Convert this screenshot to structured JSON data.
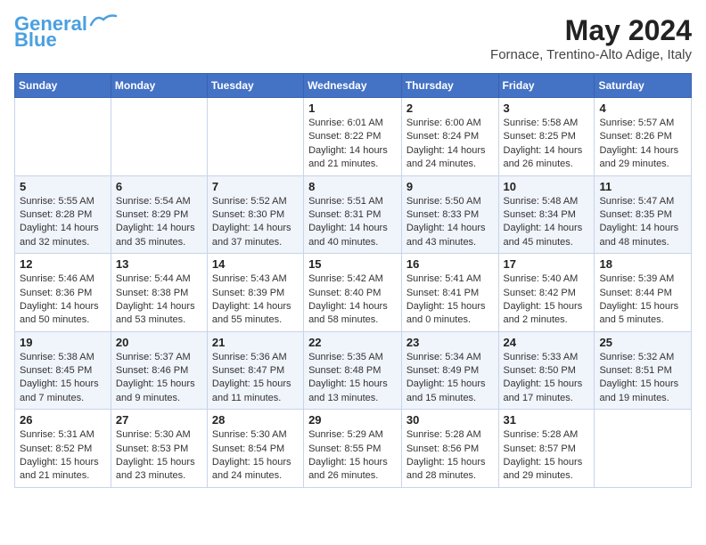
{
  "header": {
    "logo_line1": "General",
    "logo_line2": "Blue",
    "month": "May 2024",
    "location": "Fornace, Trentino-Alto Adige, Italy"
  },
  "weekdays": [
    "Sunday",
    "Monday",
    "Tuesday",
    "Wednesday",
    "Thursday",
    "Friday",
    "Saturday"
  ],
  "weeks": [
    [
      {
        "day": "",
        "info": ""
      },
      {
        "day": "",
        "info": ""
      },
      {
        "day": "",
        "info": ""
      },
      {
        "day": "1",
        "info": "Sunrise: 6:01 AM\nSunset: 8:22 PM\nDaylight: 14 hours and 21 minutes."
      },
      {
        "day": "2",
        "info": "Sunrise: 6:00 AM\nSunset: 8:24 PM\nDaylight: 14 hours and 24 minutes."
      },
      {
        "day": "3",
        "info": "Sunrise: 5:58 AM\nSunset: 8:25 PM\nDaylight: 14 hours and 26 minutes."
      },
      {
        "day": "4",
        "info": "Sunrise: 5:57 AM\nSunset: 8:26 PM\nDaylight: 14 hours and 29 minutes."
      }
    ],
    [
      {
        "day": "5",
        "info": "Sunrise: 5:55 AM\nSunset: 8:28 PM\nDaylight: 14 hours and 32 minutes."
      },
      {
        "day": "6",
        "info": "Sunrise: 5:54 AM\nSunset: 8:29 PM\nDaylight: 14 hours and 35 minutes."
      },
      {
        "day": "7",
        "info": "Sunrise: 5:52 AM\nSunset: 8:30 PM\nDaylight: 14 hours and 37 minutes."
      },
      {
        "day": "8",
        "info": "Sunrise: 5:51 AM\nSunset: 8:31 PM\nDaylight: 14 hours and 40 minutes."
      },
      {
        "day": "9",
        "info": "Sunrise: 5:50 AM\nSunset: 8:33 PM\nDaylight: 14 hours and 43 minutes."
      },
      {
        "day": "10",
        "info": "Sunrise: 5:48 AM\nSunset: 8:34 PM\nDaylight: 14 hours and 45 minutes."
      },
      {
        "day": "11",
        "info": "Sunrise: 5:47 AM\nSunset: 8:35 PM\nDaylight: 14 hours and 48 minutes."
      }
    ],
    [
      {
        "day": "12",
        "info": "Sunrise: 5:46 AM\nSunset: 8:36 PM\nDaylight: 14 hours and 50 minutes."
      },
      {
        "day": "13",
        "info": "Sunrise: 5:44 AM\nSunset: 8:38 PM\nDaylight: 14 hours and 53 minutes."
      },
      {
        "day": "14",
        "info": "Sunrise: 5:43 AM\nSunset: 8:39 PM\nDaylight: 14 hours and 55 minutes."
      },
      {
        "day": "15",
        "info": "Sunrise: 5:42 AM\nSunset: 8:40 PM\nDaylight: 14 hours and 58 minutes."
      },
      {
        "day": "16",
        "info": "Sunrise: 5:41 AM\nSunset: 8:41 PM\nDaylight: 15 hours and 0 minutes."
      },
      {
        "day": "17",
        "info": "Sunrise: 5:40 AM\nSunset: 8:42 PM\nDaylight: 15 hours and 2 minutes."
      },
      {
        "day": "18",
        "info": "Sunrise: 5:39 AM\nSunset: 8:44 PM\nDaylight: 15 hours and 5 minutes."
      }
    ],
    [
      {
        "day": "19",
        "info": "Sunrise: 5:38 AM\nSunset: 8:45 PM\nDaylight: 15 hours and 7 minutes."
      },
      {
        "day": "20",
        "info": "Sunrise: 5:37 AM\nSunset: 8:46 PM\nDaylight: 15 hours and 9 minutes."
      },
      {
        "day": "21",
        "info": "Sunrise: 5:36 AM\nSunset: 8:47 PM\nDaylight: 15 hours and 11 minutes."
      },
      {
        "day": "22",
        "info": "Sunrise: 5:35 AM\nSunset: 8:48 PM\nDaylight: 15 hours and 13 minutes."
      },
      {
        "day": "23",
        "info": "Sunrise: 5:34 AM\nSunset: 8:49 PM\nDaylight: 15 hours and 15 minutes."
      },
      {
        "day": "24",
        "info": "Sunrise: 5:33 AM\nSunset: 8:50 PM\nDaylight: 15 hours and 17 minutes."
      },
      {
        "day": "25",
        "info": "Sunrise: 5:32 AM\nSunset: 8:51 PM\nDaylight: 15 hours and 19 minutes."
      }
    ],
    [
      {
        "day": "26",
        "info": "Sunrise: 5:31 AM\nSunset: 8:52 PM\nDaylight: 15 hours and 21 minutes."
      },
      {
        "day": "27",
        "info": "Sunrise: 5:30 AM\nSunset: 8:53 PM\nDaylight: 15 hours and 23 minutes."
      },
      {
        "day": "28",
        "info": "Sunrise: 5:30 AM\nSunset: 8:54 PM\nDaylight: 15 hours and 24 minutes."
      },
      {
        "day": "29",
        "info": "Sunrise: 5:29 AM\nSunset: 8:55 PM\nDaylight: 15 hours and 26 minutes."
      },
      {
        "day": "30",
        "info": "Sunrise: 5:28 AM\nSunset: 8:56 PM\nDaylight: 15 hours and 28 minutes."
      },
      {
        "day": "31",
        "info": "Sunrise: 5:28 AM\nSunset: 8:57 PM\nDaylight: 15 hours and 29 minutes."
      },
      {
        "day": "",
        "info": ""
      }
    ]
  ]
}
